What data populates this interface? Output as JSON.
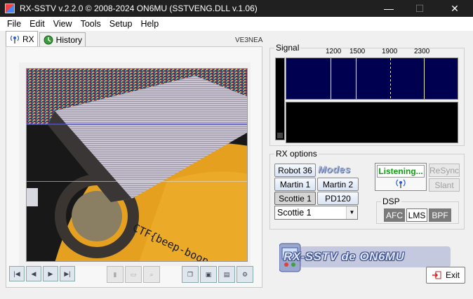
{
  "window": {
    "title": "RX-SSTV v.2.2.0 © 2008-2024 ON6MU (SSTVENG.DLL v.1.06)",
    "min_glyph": "—",
    "max_glyph": "☐",
    "close_glyph": "✕"
  },
  "menu": [
    "File",
    "Edit",
    "View",
    "Tools",
    "Setup",
    "Help"
  ],
  "tabs": [
    {
      "label": "RX",
      "icon": "antenna-icon"
    },
    {
      "label": "History",
      "icon": "history-icon"
    }
  ],
  "callsign": "VE3NEA",
  "signal": {
    "label": "Signal",
    "freq_markers": [
      "1200",
      "1500",
      "1900",
      "2300"
    ]
  },
  "rx_options": {
    "label": "RX options",
    "modes_logo": "Modes",
    "modes": [
      "Robot 36",
      "Martin 1",
      "Martin 2",
      "Scottie 1",
      "PD120"
    ],
    "selected_mode": "Scottie 1",
    "select_value": "Scottie 1"
  },
  "status": {
    "listening": "Listening...",
    "resync": "ReSync",
    "slant": "Slant"
  },
  "dsp": {
    "label": "DSP",
    "buttons": [
      {
        "label": "AFC",
        "active": true
      },
      {
        "label": "LMS",
        "active": false
      },
      {
        "label": "BPF",
        "active": true
      }
    ]
  },
  "image_caption": "CTF{beep-boop-in-space}",
  "logo_text": "RX-SSTV de ON6MU",
  "exit_label": "Exit",
  "colors": {
    "spectrum_bg": "#000050",
    "listening_text": "#10a010",
    "dsp_active": "#7a7a7a"
  }
}
